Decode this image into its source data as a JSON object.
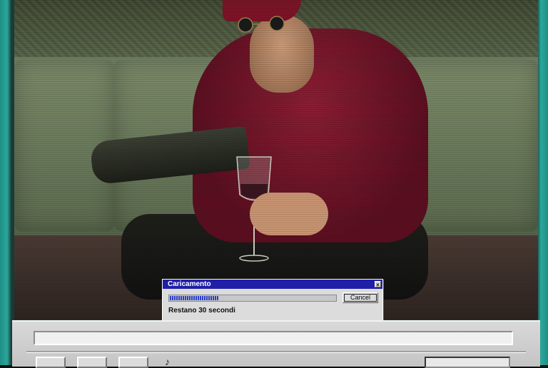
{
  "dialog": {
    "title": "Caricamento",
    "cancel_label": "Cancel",
    "close_glyph": "×",
    "remaining_text": "Restano 30 secondi",
    "progress": 0.3
  },
  "player": {
    "note_icon": "♪"
  },
  "colors": {
    "title_bar": "#1f1fa8",
    "progress_fill": "#2a3fc7",
    "frame_accent": "#2aa79b"
  }
}
